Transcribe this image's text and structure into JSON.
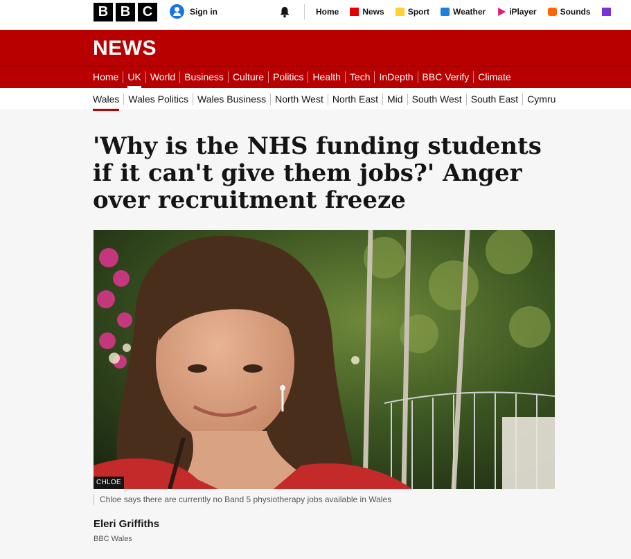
{
  "brand": {
    "letters": [
      "B",
      "B",
      "C"
    ]
  },
  "account": {
    "signin_label": "Sign in"
  },
  "top_nav": [
    {
      "label": "Home",
      "icon": ""
    },
    {
      "label": "News",
      "icon": "news-icon"
    },
    {
      "label": "Sport",
      "icon": "sport-icon"
    },
    {
      "label": "Weather",
      "icon": "weather-icon"
    },
    {
      "label": "iPlayer",
      "icon": "iplayer-icon"
    },
    {
      "label": "Sounds",
      "icon": "sounds-icon"
    }
  ],
  "masthead": {
    "title": "NEWS",
    "color": "#b80000"
  },
  "main_nav": [
    "Home",
    "UK",
    "World",
    "Business",
    "Culture",
    "Politics",
    "Health",
    "Tech",
    "InDepth",
    "BBC Verify",
    "Climate"
  ],
  "main_nav_active": "UK",
  "sub_nav": [
    "Wales",
    "Wales Politics",
    "Wales Business",
    "North West",
    "North East",
    "Mid",
    "South West",
    "South East",
    "Cymru"
  ],
  "sub_nav_active": "Wales",
  "article": {
    "headline": "'Why is the NHS funding students if it can't give them jobs?' Anger over recruitment freeze",
    "image_credit": "CHLOE",
    "image_caption": "Chloe says there are currently no Band 5 physiotherapy jobs available in Wales",
    "author": "Eleri Griffiths",
    "author_org": "BBC Wales"
  }
}
